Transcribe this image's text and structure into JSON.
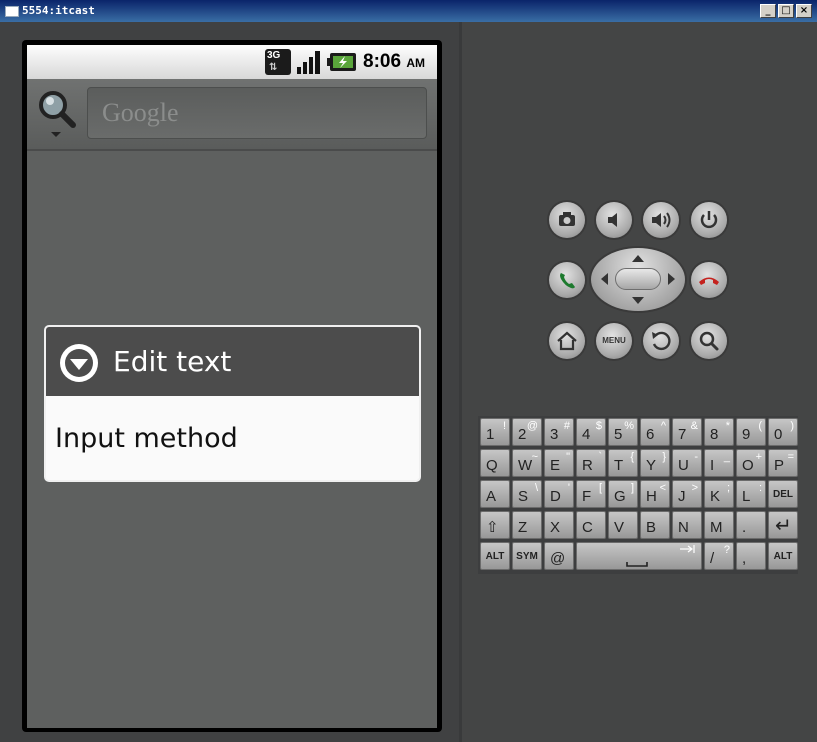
{
  "window": {
    "title": "5554:itcast",
    "controls": {
      "minimize": "_",
      "maximize": "□",
      "close": "×"
    }
  },
  "statusbar": {
    "network": "3G",
    "time": "8:06",
    "ampm": "AM",
    "icons": [
      "network-3g-icon",
      "signal-icon",
      "battery-charging-icon"
    ]
  },
  "search": {
    "placeholder": "Google",
    "icon": "search-icon"
  },
  "dialog": {
    "title": "Edit text",
    "icon": "dropdown-circle-icon",
    "items": [
      "Input method"
    ]
  },
  "controls": {
    "buttons": [
      "camera",
      "volume-down",
      "volume-up",
      "power",
      "call",
      "dpad",
      "end-call",
      "home",
      "menu",
      "back",
      "search"
    ],
    "menu_label": "MENU"
  },
  "keyboard": {
    "rows": [
      [
        [
          "1",
          "!"
        ],
        [
          "2",
          "@"
        ],
        [
          "3",
          "#"
        ],
        [
          "4",
          "$"
        ],
        [
          "5",
          "%"
        ],
        [
          "6",
          "^"
        ],
        [
          "7",
          "&"
        ],
        [
          "8",
          "*"
        ],
        [
          "9",
          "("
        ],
        [
          "0",
          ")"
        ]
      ],
      [
        [
          "Q",
          ""
        ],
        [
          "W",
          "~"
        ],
        [
          "E",
          "\""
        ],
        [
          "R",
          "`"
        ],
        [
          "T",
          "{"
        ],
        [
          "Y",
          "}"
        ],
        [
          "U",
          "-"
        ],
        [
          "I",
          "_"
        ],
        [
          "O",
          "+"
        ],
        [
          "P",
          "="
        ]
      ],
      [
        [
          "A",
          ""
        ],
        [
          "S",
          "\\"
        ],
        [
          "D",
          "'"
        ],
        [
          "F",
          "["
        ],
        [
          "G",
          "]"
        ],
        [
          "H",
          "<"
        ],
        [
          "J",
          ">"
        ],
        [
          "K",
          ";"
        ],
        [
          "L",
          ":"
        ],
        [
          "DEL",
          ""
        ]
      ],
      [
        [
          "⇧",
          ""
        ],
        [
          "Z",
          ""
        ],
        [
          "X",
          ""
        ],
        [
          "C",
          ""
        ],
        [
          "V",
          ""
        ],
        [
          "B",
          ""
        ],
        [
          "N",
          ""
        ],
        [
          "M",
          ""
        ],
        [
          ".",
          ""
        ],
        [
          "↵",
          ""
        ]
      ],
      [
        [
          "ALT",
          ""
        ],
        [
          "SYM",
          ""
        ],
        [
          "@",
          ""
        ],
        [
          "",
          ""
        ],
        [
          "/",
          "?"
        ],
        [
          ",",
          ""
        ],
        [
          "ALT",
          ""
        ]
      ]
    ]
  },
  "colors": {
    "screen_bg": "#5e605f",
    "dialog_header": "#4c4c4c",
    "titlebar": "#0a246a",
    "call_green": "#1d7a2e",
    "end_call_red": "#c4221e"
  }
}
